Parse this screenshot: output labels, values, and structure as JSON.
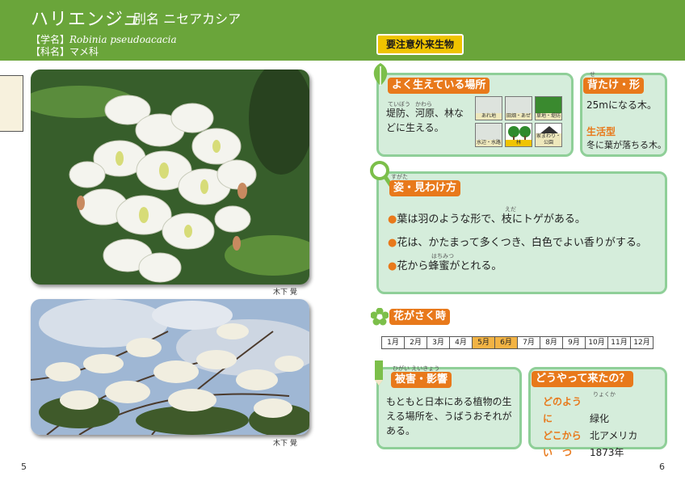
{
  "header": {
    "title": "ハリエンジュ",
    "alias": "別名 ニセアカシア",
    "scientific_label": "【学名】",
    "scientific_name": "Robinia pseudoacacia",
    "family_label": "【科名】",
    "family_name": "マメ科",
    "warning_badge": "要注意外来生物"
  },
  "photos": [
    {
      "credit": "木下 覺"
    },
    {
      "credit": "木下 覺"
    }
  ],
  "habitat": {
    "title": "よく生えている場所",
    "text": "堤防、河原、林などに生える。",
    "ruby_1": "ていぼう",
    "ruby_2": "かわら",
    "icons": [
      {
        "label": "あれ地"
      },
      {
        "label": "田畑・あぜ"
      },
      {
        "label": "草地・堤防"
      },
      {
        "label": "水辺・水路"
      },
      {
        "label": "林"
      },
      {
        "label": "家まわり・公園"
      }
    ]
  },
  "size": {
    "title": "背たけ・形",
    "ruby": "せ",
    "text": "25mになる木。",
    "lifeform_title": "生活型",
    "lifeform_text": "冬に葉が落ちる木。"
  },
  "appearance": {
    "title": "姿・見わけ方",
    "ruby": "すがた",
    "bullets": [
      "葉は羽のような形で、枝にトゲがある。",
      "花は、かたまって多くつき、白色でよい香りがする。",
      "花から蜂蜜がとれる。"
    ],
    "ruby_branch": "えだ",
    "ruby_honey": "はちみつ"
  },
  "flowering": {
    "title": "花がさく時",
    "months": [
      "1月",
      "2月",
      "3月",
      "4月",
      "5月",
      "6月",
      "7月",
      "8月",
      "9月",
      "10月",
      "11月",
      "12月"
    ],
    "active": [
      4,
      5
    ]
  },
  "damage": {
    "title": "被害・影響",
    "ruby": "ひがい  えいきょう",
    "text": "もともと日本にある植物の生える場所を、うばうおそれがある。"
  },
  "origin": {
    "title": "どうやって来たの？",
    "rows": [
      {
        "key": "どのように",
        "value": "緑化"
      },
      {
        "key": "どこから",
        "value": "北アメリカ"
      },
      {
        "key": "い　つ",
        "value": "1873年"
      }
    ],
    "ruby": "りょくか"
  },
  "pages": {
    "left": "5",
    "right": "6"
  },
  "colors": {
    "header_green": "#6aa53a",
    "panel_bg": "#d5eddb",
    "panel_border": "#8fcf98",
    "title_orange": "#e8791b",
    "warn_yellow": "#f0c400"
  }
}
